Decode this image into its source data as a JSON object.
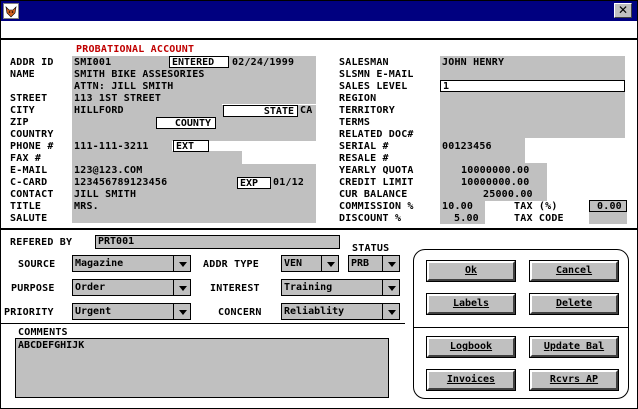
{
  "header": {
    "probational": "PROBATIONAL ACCOUNT"
  },
  "left": {
    "addr_id_label": "ADDR ID",
    "addr_id": "SMI001",
    "entered_label": "ENTERED",
    "entered": "02/24/1999",
    "name_label": "NAME",
    "name1": "SMITH BIKE ASSESORIES",
    "name2": "ATTN: JILL SMITH",
    "street_label": "STREET",
    "street": "113 1ST STREET",
    "city_label": "CITY",
    "city": "HILLFORD",
    "state_label": "STATE",
    "state": "CA",
    "zip_label": "ZIP",
    "county_label": "COUNTY",
    "country_label": "COUNTRY",
    "phone_label": "PHONE #",
    "phone": "111-111-3211",
    "ext_label": "EXT",
    "fax_label": "FAX #",
    "email_label": "E-MAIL",
    "email": "123@123.COM",
    "ccard_label": "C-CARD",
    "ccard": "123456789123456",
    "exp_label": "EXP",
    "exp": "01/12",
    "contact_label": "CONTACT",
    "contact": "JILL SMITH",
    "title_label": "TITLE",
    "title": "MRS.",
    "salute_label": "SALUTE"
  },
  "right": {
    "salesman_label": "SALESMAN",
    "salesman": "JOHN HENRY",
    "slsmn_email_label": "SLSMN E-MAIL",
    "sales_level_label": "SALES LEVEL",
    "sales_level": "1",
    "region_label": "REGION",
    "territory_label": "TERRITORY",
    "terms_label": "TERMS",
    "related_doc_label": "RELATED DOC#",
    "serial_label": "SERIAL #",
    "serial": "00123456",
    "resale_label": "RESALE #",
    "yearly_quota_label": "YEARLY QUOTA",
    "yearly_quota": "10000000.00",
    "credit_limit_label": "CREDIT LIMIT",
    "credit_limit": "10000000.00",
    "cur_balance_label": "CUR BALANCE",
    "cur_balance": "25000.00",
    "commission_label": "COMMISSION %",
    "commission": "10.00",
    "tax_label": "TAX (%)",
    "tax": "0.00",
    "discount_label": "DISCOUNT %",
    "discount": "5.00",
    "tax_code_label": "TAX CODE"
  },
  "bottom": {
    "refered_by_label": "REFERED BY",
    "refered_by": "PRT001",
    "status_label": "STATUS",
    "status": "PRB",
    "source_label": "SOURCE",
    "source": "Magazine",
    "addr_type_label": "ADDR TYPE",
    "addr_type": "VEN",
    "purpose_label": "PURPOSE",
    "purpose": "Order",
    "interest_label": "INTEREST",
    "interest": "Training",
    "priority_label": "PRIORITY",
    "priority": "Urgent",
    "concern_label": "CONCERN",
    "concern": "Reliablity",
    "comments_label": "COMMENTS",
    "comments": "ABCDEFGHIJK"
  },
  "buttons": {
    "ok": "Ok",
    "cancel": "Cancel",
    "labels": "Labels",
    "delete": "Delete",
    "logbook": "Logbook",
    "update_bal": "Update Bal",
    "invoices": "Invoices",
    "rcvrs_ap": "Rcvrs AP"
  },
  "colors": {
    "titlebar": "#000080",
    "field_gray": "#c0c0c0",
    "probational": "#c00000"
  },
  "icons": {
    "app": "fox-app-icon",
    "close": "close-x-icon"
  }
}
